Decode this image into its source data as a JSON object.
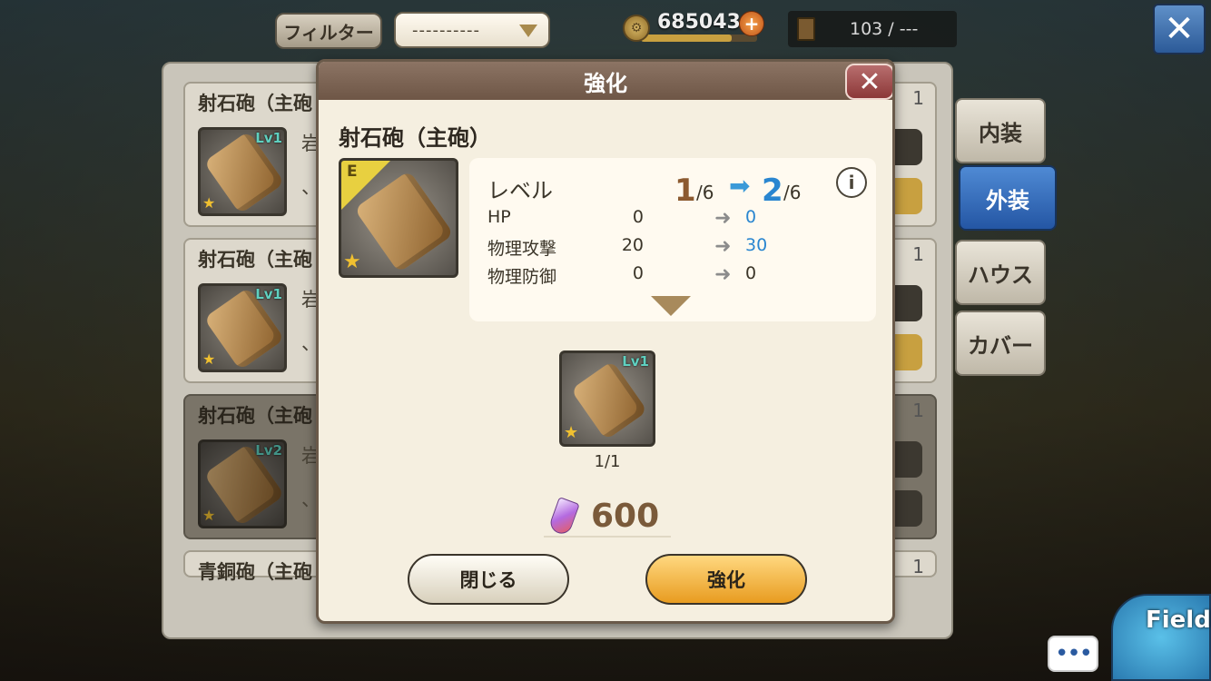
{
  "topbar": {
    "filter_label": "フィルター",
    "filter_value": "----------",
    "coins": "685043",
    "slots": "103 / ---"
  },
  "list": {
    "items": [
      {
        "name": "射石砲（主砲",
        "lv": "Lv1",
        "desc": "岩",
        "desc2": "、",
        "count": "1",
        "dark": false
      },
      {
        "name": "射石砲（主砲",
        "lv": "Lv1",
        "desc": "岩",
        "desc2": "、",
        "count": "1",
        "dark": false
      },
      {
        "name": "射石砲（主砲",
        "lv": "Lv2",
        "desc": "岩",
        "desc2": "、",
        "count": "1",
        "dark": true
      },
      {
        "name": "青銅砲（主砲",
        "count": "1",
        "dark": false
      }
    ]
  },
  "side_tabs": [
    "内装",
    "外装",
    "ハウス",
    "カバー"
  ],
  "modal": {
    "title": "強化",
    "item_name": "射石砲（主砲）",
    "equip_badge": "E",
    "level_label": "レベル",
    "level_cur": "1",
    "level_cur_max": "/6",
    "level_next": "2",
    "level_next_max": "/6",
    "stats": [
      {
        "label": "HP",
        "cur": "0",
        "next": "0",
        "changed": true
      },
      {
        "label": "物理攻撃",
        "cur": "20",
        "next": "30",
        "changed": true
      },
      {
        "label": "物理防御",
        "cur": "0",
        "next": "0",
        "changed": false
      }
    ],
    "material_lv": "Lv1",
    "material_count": "1/1",
    "cost": "600",
    "close_label": "閉じる",
    "enhance_label": "強化"
  },
  "field_label": "Field",
  "chat_label": "•••",
  "colors": {
    "accent_blue": "#2a86d0",
    "level_brown": "#8c5a30",
    "enhance_orange": "#e89c20"
  }
}
